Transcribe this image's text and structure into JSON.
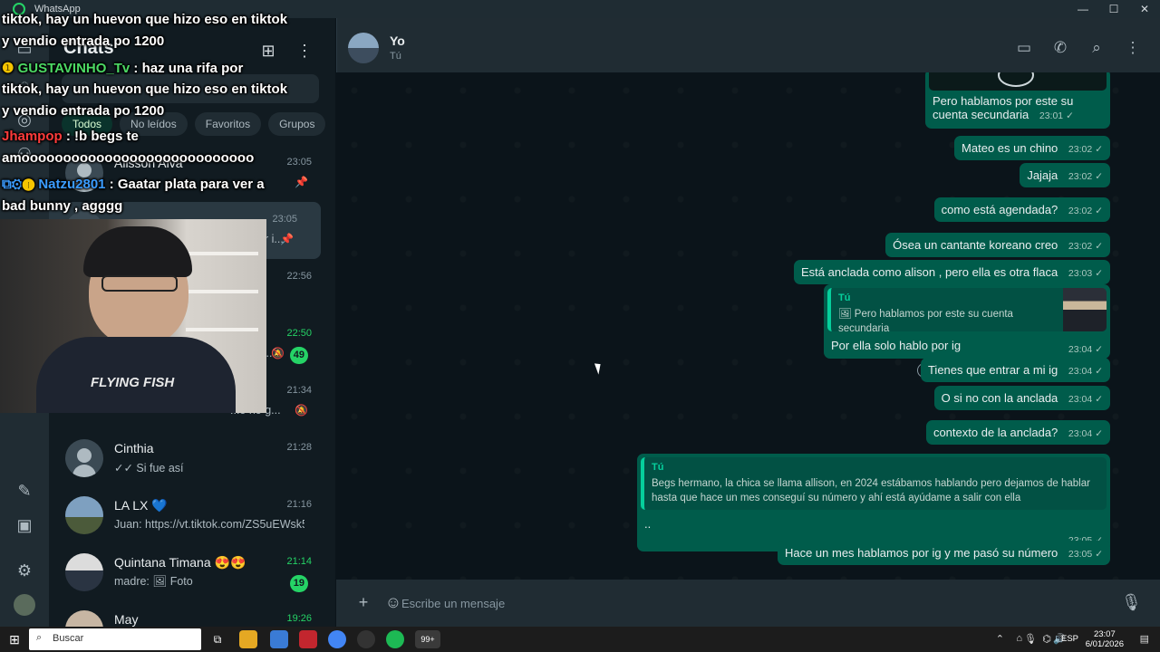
{
  "window": {
    "app_title": "WhatsApp",
    "minimize": "—",
    "maximize": "☐",
    "close": "✕"
  },
  "chatlist": {
    "title": "Chats",
    "filters": [
      "Todos",
      "No leídos",
      "Favoritos",
      "Grupos"
    ],
    "chats": [
      {
        "name": "Alisson Alva",
        "time": "23:05",
        "preview": "",
        "pinned": true
      },
      {
        "name": "",
        "time": "23:05",
        "preview": "r i...",
        "pinned": true
      },
      {
        "name": "",
        "time": "22:56",
        "preview": ""
      },
      {
        "name": "",
        "time": "22:50",
        "preview": "...",
        "unread": "49",
        "muted": true
      },
      {
        "name": "",
        "time": "21:34",
        "preview": "...o no g...",
        "muted": true
      },
      {
        "name": "Cinthia",
        "time": "21:28",
        "preview": "✓✓ Si fue así"
      },
      {
        "name": "LA LX 💙",
        "time": "21:16",
        "preview": "Juan: https://vt.tiktok.com/ZS5uEWsk5/"
      },
      {
        "name": "Quintana Timana 😍😍",
        "time": "21:14",
        "preview": "madre: 🖼 Foto",
        "unread": "19"
      },
      {
        "name": "May",
        "time": "19:26",
        "preview": ""
      }
    ]
  },
  "chat": {
    "contact_name": "Yo",
    "contact_sub": "Tú",
    "messages": [
      {
        "text": "Pero hablamos por este su cuenta secundaria",
        "time": "23:01"
      },
      {
        "text": "Mateo es un chino",
        "time": "23:02"
      },
      {
        "text": "Jajaja",
        "time": "23:02"
      },
      {
        "text": "como está agendada?",
        "time": "23:02"
      },
      {
        "text": "Ósea un cantante koreano creo",
        "time": "23:02"
      },
      {
        "text": "Está anclada como alison , pero ella es otra flaca",
        "time": "23:03"
      },
      {
        "quote_author": "Tú",
        "quote_text": "🖼 Pero hablamos por este su cuenta secundaria",
        "text": "Por ella solo hablo por ig",
        "time": "23:04"
      },
      {
        "text": "Tienes que entrar a mi ig",
        "time": "23:04"
      },
      {
        "text": "O si no con la anclada",
        "time": "23:04"
      },
      {
        "text": "contexto de la anclada?",
        "time": "23:04"
      },
      {
        "quote_author": "Tú",
        "quote_text": "Begs hermano, la chica se llama allison, en 2024 estábamos hablando pero dejamos de hablar hasta que hace un mes conseguí su número y ahí está ayúdame a salir con ella",
        "text": "..",
        "time": "23:05"
      },
      {
        "text": "Hace un mes hablamos por ig y me pasó su número",
        "time": "23:05"
      }
    ],
    "composer_placeholder": "Escribe un mensaje"
  },
  "overlay": {
    "lines": [
      {
        "user": "",
        "text": "tiktok, hay un huevon que hizo eso en tiktok"
      },
      {
        "user": "",
        "text": "y vendio entrada po 1200"
      },
      {
        "user": "GUSTAVINHO_Tv",
        "text": " : haz una rifa por"
      },
      {
        "user": "",
        "text": "tiktok, hay un huevon que hizo eso en tiktok"
      },
      {
        "user": "",
        "text": "y vendio entrada po 1200"
      },
      {
        "user": "Jhampop",
        "text": " : !b begs te"
      },
      {
        "user": "",
        "text": "amoooooooooooooooooooooooooooo"
      },
      {
        "user": "Natzu2801",
        "text": " : Gaatar plata para ver a"
      },
      {
        "user": "",
        "text": "bad bunny , agggg"
      }
    ],
    "colors": {
      "gustavinho": "#4cd964",
      "jhampop": "#ff3b3b",
      "natzu": "#3b9cff"
    },
    "webcam_shirt": "FLYING FISH"
  },
  "taskbar": {
    "search_label": "Buscar",
    "lang": "ESP",
    "time": "23:07",
    "date": "6/01/2026"
  },
  "colors": {
    "bubble_out": "#005c4b",
    "accent": "#25d366",
    "app_bg": "#0b141a"
  }
}
